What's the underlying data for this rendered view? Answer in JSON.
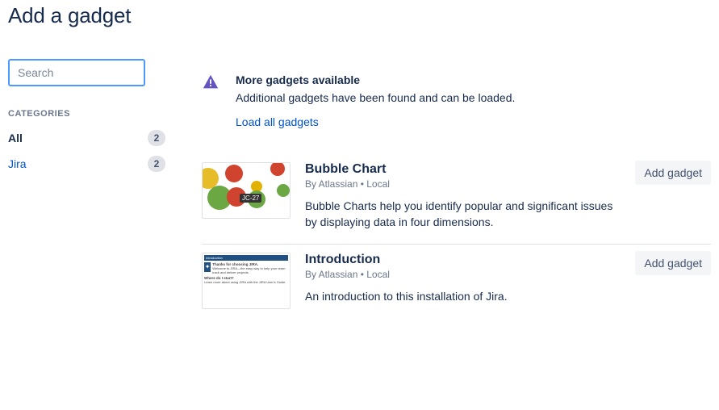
{
  "page_title": "Add a gadget",
  "search": {
    "placeholder": "Search",
    "value": ""
  },
  "sidebar": {
    "heading": "CATEGORIES",
    "items": [
      {
        "label": "All",
        "count": "2",
        "active": true
      },
      {
        "label": "Jira",
        "count": "2",
        "active": false
      }
    ]
  },
  "notice": {
    "title": "More gadgets available",
    "description": "Additional gadgets have been found and can be loaded.",
    "link": "Load all gadgets"
  },
  "gadgets": [
    {
      "title": "Bubble Chart",
      "meta": "By Atlassian • Local",
      "description": "Bubble Charts help you identify popular and significant issues by displaying data in four dimensions.",
      "button": "Add gadget",
      "thumb_badge": "JC-27"
    },
    {
      "title": "Introduction",
      "meta": "By Atlassian • Local",
      "description": "An introduction to this installation of Jira.",
      "button": "Add gadget"
    }
  ]
}
